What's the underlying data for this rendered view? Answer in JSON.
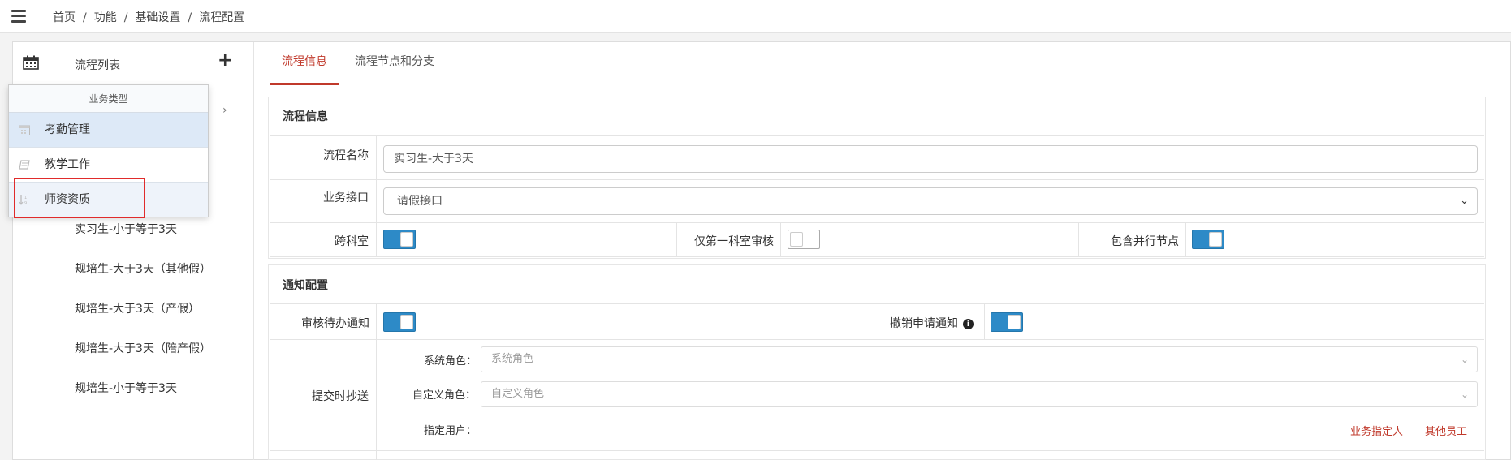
{
  "breadcrumb": [
    "首页",
    "功能",
    "基础设置",
    "流程配置"
  ],
  "sidebar": {
    "title": "流程列表",
    "add_symbol": "+",
    "chevron": "›",
    "workflows": [
      "实习生-小于等于3天",
      "规培生-大于3天（其他假）",
      "规培生-大于3天（产假）",
      "规培生-大于3天（陪产假）",
      "规培生-小于等于3天"
    ]
  },
  "dropdown": {
    "header": "业务类型",
    "items": [
      {
        "label": "考勤管理",
        "icon": "calendar-icon",
        "state": "active"
      },
      {
        "label": "教学工作",
        "icon": "book-icon",
        "state": "normal"
      },
      {
        "label": "师资资质",
        "icon": "sort-icon",
        "state": "hover"
      }
    ]
  },
  "tabs": [
    {
      "label": "流程信息",
      "active": true
    },
    {
      "label": "流程节点和分支",
      "active": false
    }
  ],
  "flow_info": {
    "section_title": "流程信息",
    "name_label": "流程名称",
    "name_value": "实习生-大于3天",
    "interface_label": "业务接口",
    "interface_value": "请假接口",
    "cross_dept_label": "跨科室",
    "cross_dept_on": true,
    "first_dept_label": "仅第一科室审核",
    "first_dept_on": false,
    "parallel_label": "包含并行节点",
    "parallel_on": true
  },
  "notify": {
    "section_title": "通知配置",
    "pending_label": "审核待办通知",
    "pending_on": true,
    "revoke_label": "撤销申请通知",
    "revoke_on": true,
    "cc_label": "提交时抄送",
    "system_role_label": "系统角色：",
    "system_role_placeholder": "系统角色",
    "custom_role_label": "自定义角色：",
    "custom_role_placeholder": "自定义角色",
    "user_label": "指定用户：",
    "link_business": "业务指定人",
    "link_other": "其他员工"
  },
  "colors": {
    "accent": "#c0392b",
    "toggle_on": "#2d8ac7",
    "highlight": "#e02b2b"
  }
}
